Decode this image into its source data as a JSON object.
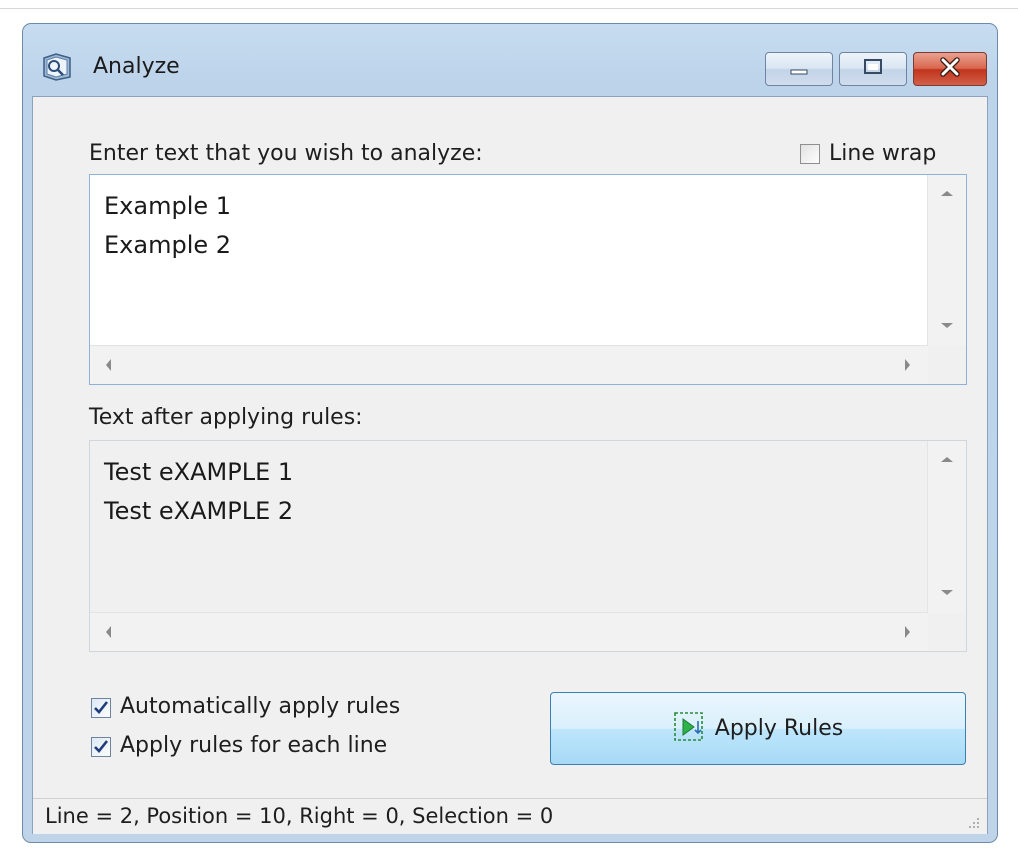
{
  "window": {
    "title": "Analyze",
    "buttons": {
      "minimize": "minimize-icon",
      "maximize": "maximize-icon",
      "close": "close-icon"
    }
  },
  "input_section": {
    "label": "Enter text that you wish to analyze:",
    "line_wrap": {
      "label": "Line wrap",
      "checked": false
    },
    "text": "Example 1\nExample 2"
  },
  "output_section": {
    "label": "Text after applying rules:",
    "text": "Test eXAMPLE 1\nTest eXAMPLE 2"
  },
  "options": {
    "auto_apply": {
      "label": "Automatically apply rules",
      "checked": true
    },
    "each_line": {
      "label": "Apply rules for each line",
      "checked": true
    }
  },
  "apply_button": {
    "label": "Apply Rules",
    "icon": "apply-rules-icon"
  },
  "status": {
    "text": "Line = 2, Position = 10, Right = 0, Selection = 0"
  },
  "colors": {
    "accent": "#3c7fb1",
    "title_bar": "#bcd3ea",
    "close_button": "#c2341c",
    "check_mark": "#1f3d7a"
  }
}
